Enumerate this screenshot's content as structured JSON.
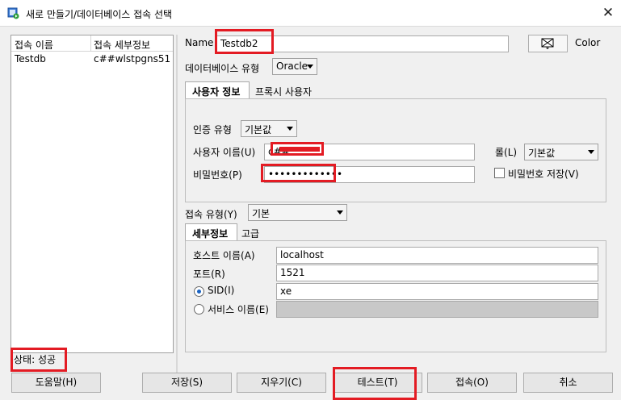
{
  "window": {
    "title": "새로 만들기/데이터베이스 접속 선택",
    "close_glyph": "✕"
  },
  "connections": {
    "columns": [
      "접속 이름",
      "접속 세부정보"
    ],
    "rows": [
      {
        "name": "Testdb",
        "details": "c##wlstpgns51..."
      }
    ]
  },
  "form": {
    "name_label": "Name",
    "name_value": "Testdb2",
    "color_label": "Color",
    "db_type_label": "데이터베이스 유형",
    "db_type_value": "Oracle",
    "tabs": [
      {
        "label": "사용자 정보",
        "active": true
      },
      {
        "label": "프록시 사용자",
        "active": false
      }
    ],
    "auth_type_label": "인증 유형",
    "auth_type_value": "기본값",
    "username_label": "사용자 이름(U)",
    "username_value": "c##",
    "role_label": "롤(L)",
    "role_value": "기본값",
    "password_label": "비밀번호(P)",
    "password_value": "•••••••••••••",
    "save_password_label": "비밀번호 저장(V)",
    "connection_type_label": "접속 유형(Y)",
    "connection_type_value": "기본",
    "detail_tabs": [
      {
        "label": "세부정보",
        "active": true
      },
      {
        "label": "고급",
        "active": false
      }
    ],
    "host_label": "호스트 이름(A)",
    "host_value": "localhost",
    "port_label": "포트(R)",
    "port_value": "1521",
    "sid_label": "SID(I)",
    "sid_value": "xe",
    "service_label": "서비스 이름(E)",
    "service_value": ""
  },
  "status": {
    "text": "상태: 성공"
  },
  "buttons": {
    "help": "도움말(H)",
    "save": "저장(S)",
    "clear": "지우기(C)",
    "test": "테스트(T)",
    "connect": "접속(O)",
    "cancel": "취소"
  },
  "colors": {
    "highlight_red": "#e31b23",
    "accent_blue": "#1a63c2"
  }
}
